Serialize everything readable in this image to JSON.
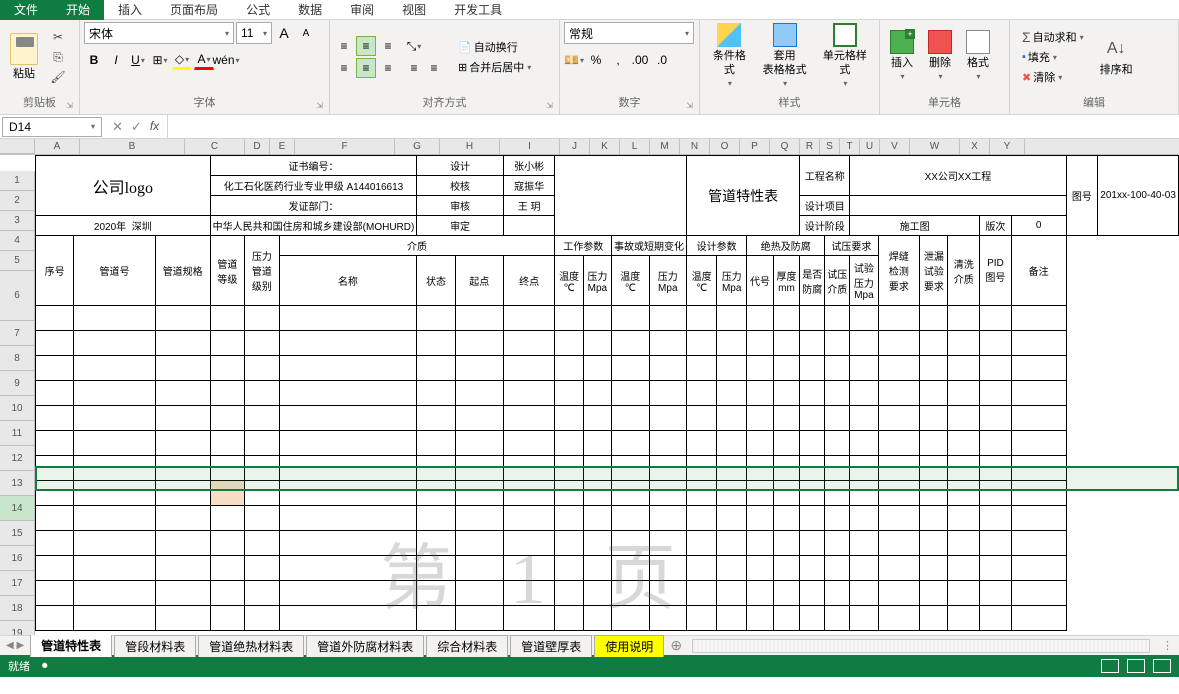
{
  "menu": {
    "file": "文件",
    "items": [
      "开始",
      "插入",
      "页面布局",
      "公式",
      "数据",
      "审阅",
      "视图",
      "开发工具"
    ],
    "active": 0
  },
  "ribbon": {
    "clipboard": {
      "paste": "粘贴",
      "label": "剪贴板"
    },
    "font": {
      "name": "宋体",
      "size": "11",
      "bold": "B",
      "italic": "I",
      "underline": "U",
      "wen": "wén",
      "label": "字体",
      "incr": "A",
      "decr": "A"
    },
    "align": {
      "wrap": "自动换行",
      "merge": "合并后居中",
      "label": "对齐方式"
    },
    "number": {
      "format": "常规",
      "percent": "%",
      "comma": ",",
      "label": "数字"
    },
    "styles": {
      "cond": "条件格式",
      "table": "套用\n表格格式",
      "cell": "单元格样式",
      "label": "样式"
    },
    "cells": {
      "insert": "插入",
      "delete": "删除",
      "format": "格式",
      "label": "单元格"
    },
    "editing": {
      "sum": "自动求和",
      "fill": "填充",
      "clear": "清除",
      "sort": "排序和",
      "label": "编辑"
    }
  },
  "namebox": "D14",
  "sheet": {
    "cols": [
      "A",
      "B",
      "C",
      "D",
      "E",
      "F",
      "G",
      "H",
      "I",
      "J",
      "K",
      "L",
      "M",
      "N",
      "O",
      "P",
      "Q",
      "R",
      "S",
      "T",
      "U",
      "V",
      "W",
      "X",
      "Y"
    ],
    "logo": "公司logo",
    "cert_label": "证书编号：",
    "cert_row1": "化工石化医药行业专业甲级 A144016613",
    "cert_row2": "发证部门：",
    "cert_row3": "中华人民共和国住房和城乡建设部(MOHURD)",
    "design": "设计",
    "designer": "张小彬",
    "check": "校核",
    "checker": "寇振华",
    "review": "审核",
    "reviewer": "王 玥",
    "approve": "审定",
    "title": "管道特性表",
    "proj_name_l": "工程名称",
    "proj_name_v": "XX公司XX工程",
    "proj_item_l": "设计项目",
    "stage_l": "设计阶段",
    "stage_v": "施工图",
    "rev_l": "版次",
    "rev_v": "0",
    "drawno_l": "图号",
    "drawno_v": "201xx-100-40-03",
    "footer": "2020年  深圳",
    "h": {
      "seq": "序号",
      "pipe": "管道号",
      "spec": "管道规格",
      "grade": "管道\n等级",
      "plevel": "压力\n管道\n级别",
      "medium": "介质",
      "m_name": "名称",
      "m_state": "状态",
      "m_start": "起点",
      "m_end": "终点",
      "work": "工作参数",
      "tc": "温度\n℃",
      "pmpa": "压力\nMpa",
      "acc": "事故或短期变化",
      "des": "设计参数",
      "insul": "绝热及防腐",
      "ins_code": "代号",
      "ins_thk": "厚度\nmm",
      "ins_anti": "是否\n防腐",
      "test": "试压要求",
      "test_m": "试压\n介质",
      "test_p": "试验\n压力\nMpa",
      "weld": "焊缝\n检测\n要求",
      "leak": "泄漏\n试验\n要求",
      "clean": "清洗\n介质",
      "pid": "PID\n图号",
      "remark": "备注"
    },
    "watermark": "第 1 页"
  },
  "tabs": {
    "items": [
      "管道特性表",
      "管段材料表",
      "管道绝热材料表",
      "管道外防腐材料表",
      "综合材料表",
      "管道壁厚表",
      "使用说明"
    ],
    "active": 0,
    "yellow": 6
  },
  "status": {
    "ready": "就绪"
  }
}
